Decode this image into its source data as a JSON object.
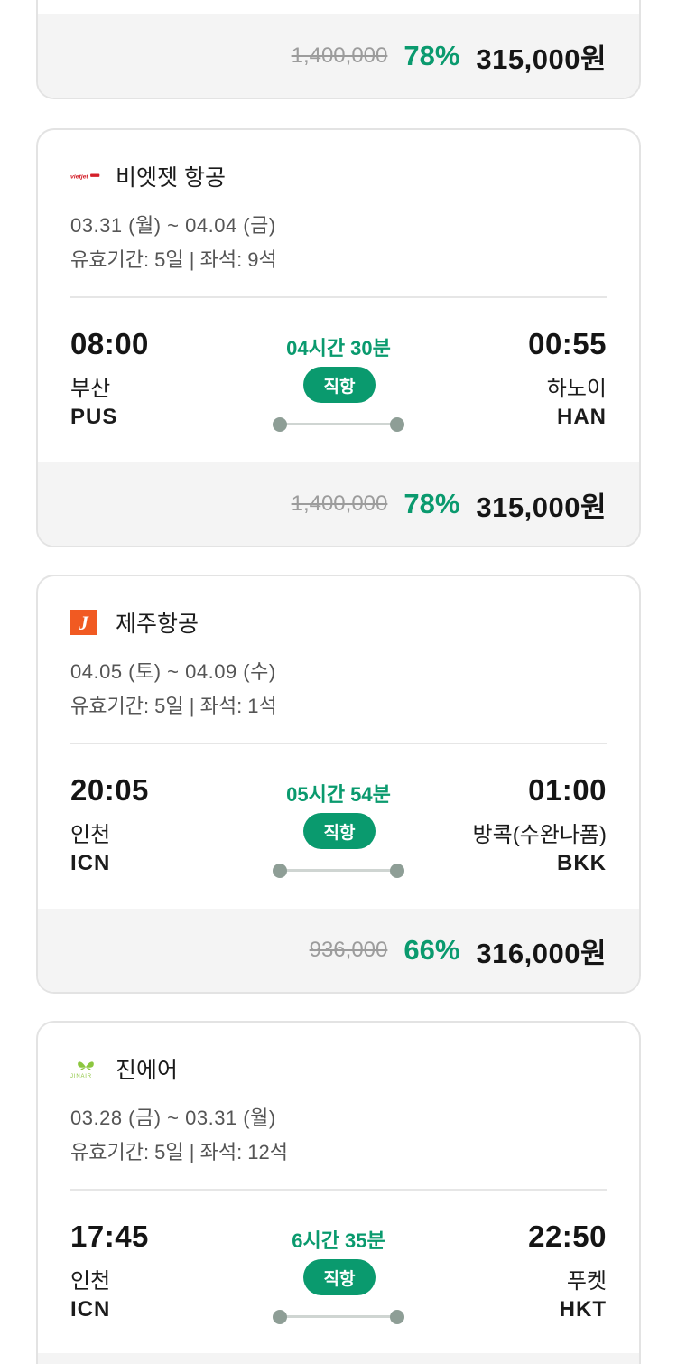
{
  "partial_card": {
    "original_price": "1,400,000",
    "discount": "78%",
    "final_price": "315,000원"
  },
  "cards": [
    {
      "airline": "비엣젯 항공",
      "logo_icon": "vietjet-logo",
      "dates": "03.31 (월) ~ 04.04 (금)",
      "validity": "유효기간: 5일 | 좌석: 9석",
      "dep_time": "08:00",
      "dep_city": "부산",
      "dep_code": "PUS",
      "duration": "04시간 30분",
      "direct_label": "직항",
      "arr_time": "00:55",
      "arr_city": "하노이",
      "arr_code": "HAN",
      "original_price": "1,400,000",
      "discount": "78%",
      "final_price": "315,000원"
    },
    {
      "airline": "제주항공",
      "logo_icon": "jejuair-logo",
      "dates": "04.05 (토) ~ 04.09 (수)",
      "validity": "유효기간: 5일 | 좌석: 1석",
      "dep_time": "20:05",
      "dep_city": "인천",
      "dep_code": "ICN",
      "duration": "05시간 54분",
      "direct_label": "직항",
      "arr_time": "01:00",
      "arr_city": "방콕(수완나폼)",
      "arr_code": "BKK",
      "original_price": "936,000",
      "discount": "66%",
      "final_price": "316,000원"
    },
    {
      "airline": "진에어",
      "logo_icon": "jinair-logo",
      "dates": "03.28 (금) ~ 03.31 (월)",
      "validity": "유효기간: 5일 | 좌석: 12석",
      "dep_time": "17:45",
      "dep_city": "인천",
      "dep_code": "ICN",
      "duration": "6시간 35분",
      "direct_label": "직항",
      "arr_time": "22:50",
      "arr_city": "푸켓",
      "arr_code": "HKT"
    }
  ],
  "colors": {
    "accent": "#0a9a6e",
    "price_bar_bg": "#f4f4f4",
    "border": "#e3e3e3"
  }
}
